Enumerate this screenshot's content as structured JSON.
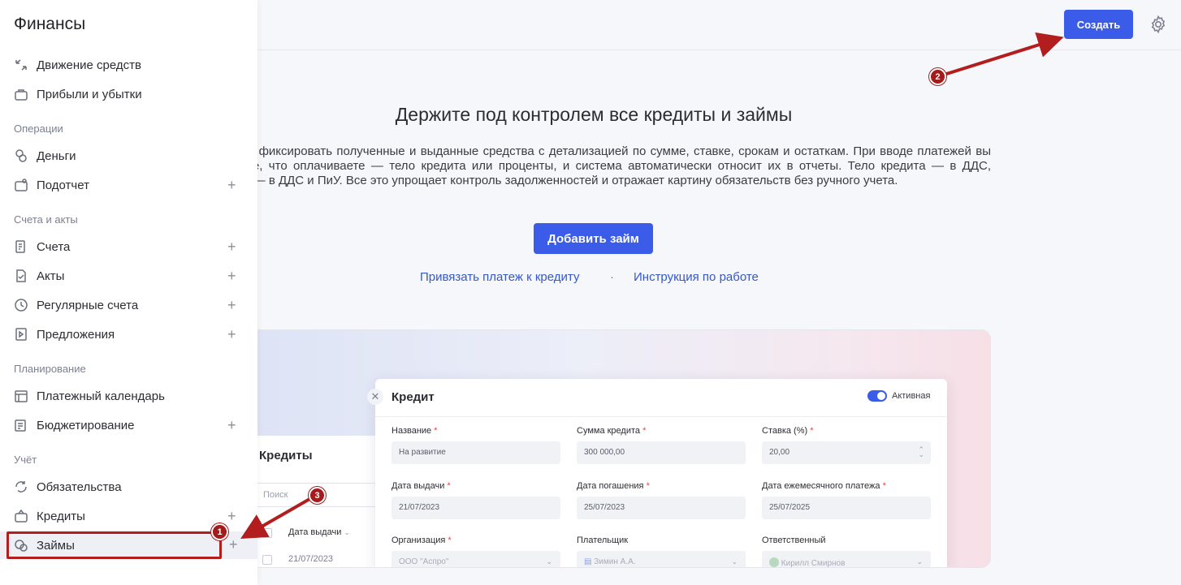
{
  "topbar": {
    "create_label": "Создать"
  },
  "main": {
    "headline": "Держите под контролем все кредиты и займы",
    "description": "Позволяет фиксировать полученные и выданные средства с детализацией по сумме, ставке, срокам и остаткам. При вводе платежей вы указываете, что оплачиваете — тело кредита или проценты, и система автоматически относит их в отчеты. Тело кредита — в ДДС, проценты — в ДДС и ПиУ. Все это упрощает контроль задолженностей и отражает картину обязательств без ручного учета.",
    "add_button": "Добавить займ",
    "link_bind": "Привязать платеж к кредиту",
    "separator": "·",
    "link_instructions": "Инструкция по работе"
  },
  "preview": {
    "credits_title": "Кредиты",
    "search_placeholder": "Поиск",
    "col_issue_date": "Дата выдачи",
    "row_date": "21/07/2023",
    "modal": {
      "title": "Кредит",
      "status_label": "Активная",
      "fields": {
        "name_label": "Название",
        "name_value": "На развитие",
        "amount_label": "Сумма кредита",
        "amount_value": "300 000,00",
        "rate_label": "Ставка (%)",
        "rate_value": "20,00",
        "issue_label": "Дата выдачи",
        "issue_value": "21/07/2023",
        "repay_label": "Дата погашения",
        "repay_value": "25/07/2023",
        "monthly_label": "Дата ежемесячного платежа",
        "monthly_value": "25/07/2025",
        "org_label": "Организация",
        "org_value": "ООО \"Аспро\"",
        "payer_label": "Плательщик",
        "payer_value": "Зимин А.А.",
        "resp_label": "Ответственный",
        "resp_value": "Кирилл Смирнов"
      }
    }
  },
  "sidebar": {
    "title": "Финансы",
    "top_items": [
      {
        "label": "Движение средств"
      },
      {
        "label": "Прибыли и убытки"
      }
    ],
    "sections": {
      "operations": "Операции",
      "invoices": "Счета и акты",
      "planning": "Планирование",
      "accounting": "Учёт"
    },
    "items": {
      "money": "Деньги",
      "subreport": "Подотчет",
      "invoices": "Счета",
      "acts": "Акты",
      "recurring": "Регулярные счета",
      "offers": "Предложения",
      "pay_calendar": "Платежный календарь",
      "budgeting": "Бюджетирование",
      "obligations": "Обязательства",
      "credits": "Кредиты",
      "loans": "Займы"
    }
  },
  "annotations": {
    "badge1": "1",
    "badge2": "2",
    "badge3": "3"
  },
  "colors": {
    "accent": "#3b5ce8",
    "annotation": "#b21e1e"
  }
}
